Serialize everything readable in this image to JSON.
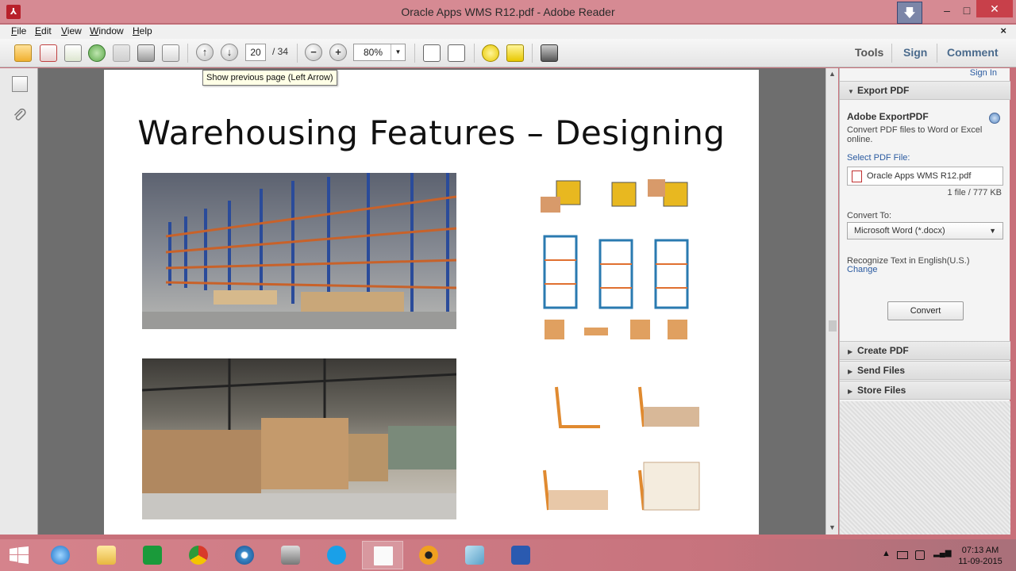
{
  "window": {
    "title": "Oracle Apps WMS R12.pdf - Adobe Reader",
    "minimize": "–",
    "maximize": "□",
    "close": "✕"
  },
  "menu": {
    "items": [
      "File",
      "Edit",
      "View",
      "Window",
      "Help"
    ],
    "close": "×"
  },
  "toolbar": {
    "page_current": "20",
    "page_total": "/ 34",
    "zoom": "80%",
    "tools_label": "Tools",
    "sign_label": "Sign",
    "comment_label": "Comment"
  },
  "tooltip": "Show previous page (Left Arrow)",
  "document": {
    "heading": "Warehousing Features – Designing"
  },
  "right_pane": {
    "sign_in": "Sign In",
    "export_pdf": "Export PDF",
    "adobe_export_title": "Adobe ExportPDF",
    "adobe_export_desc": "Convert PDF files to Word or Excel online.",
    "select_file_label": "Select PDF File:",
    "file_name": "Oracle Apps WMS R12.pdf",
    "file_info": "1 file / 777 KB",
    "convert_to_label": "Convert To:",
    "convert_to_value": "Microsoft Word (*.docx)",
    "recognize_text": "Recognize Text in English(U.S.)",
    "change_link": "Change",
    "convert_button": "Convert",
    "create_pdf": "Create PDF",
    "send_files": "Send Files",
    "store_files": "Store Files"
  },
  "taskbar": {
    "time": "07:13 AM",
    "date": "11-09-2015"
  },
  "colors": {
    "accent": "#4a6a8c",
    "link": "#2a5aa0",
    "titlebar": "#d68a93",
    "taskbar": "#c7737d"
  }
}
